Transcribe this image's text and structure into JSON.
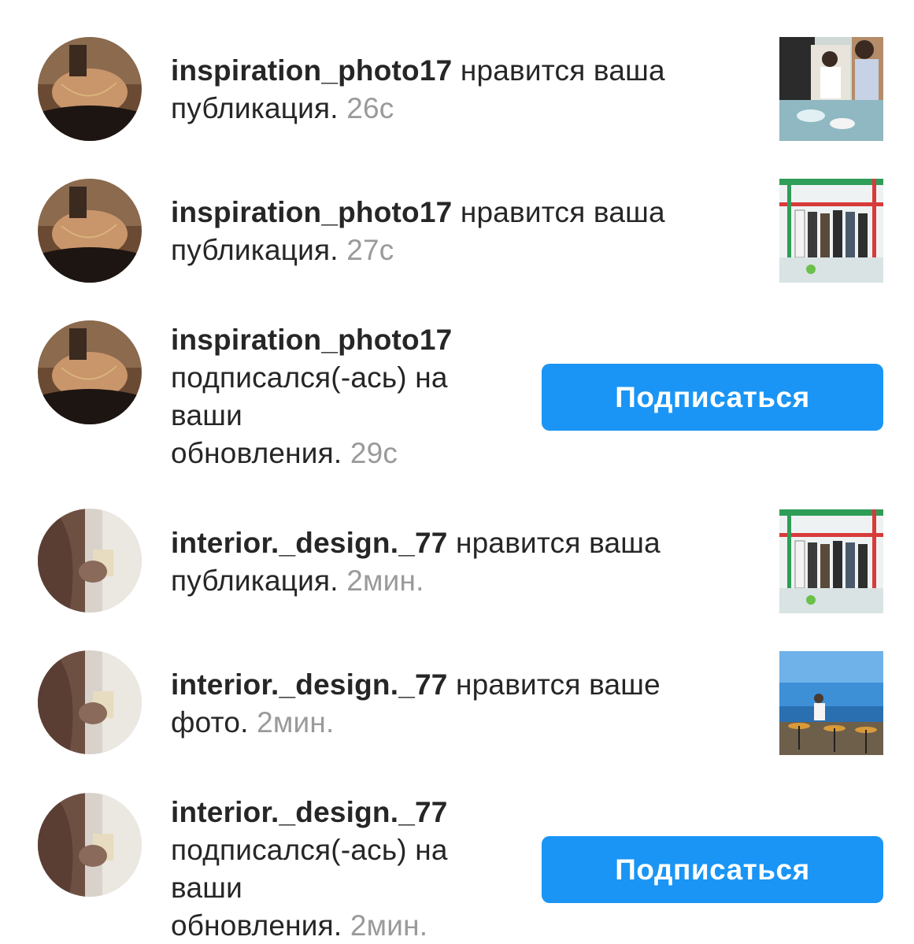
{
  "notifications": [
    {
      "username": "inspiration_photo17",
      "line1_rest": " нравится ваша",
      "line2_text": "публикация.",
      "time": "26с",
      "avatar_icon": "user-avatar-woman-dark",
      "thumbnail_icon": "post-thumbnail-kitchen"
    },
    {
      "username": "inspiration_photo17",
      "line1_rest": " нравится ваша",
      "line2_text": "публикация.",
      "time": "27с",
      "avatar_icon": "user-avatar-woman-dark",
      "thumbnail_icon": "post-thumbnail-group"
    },
    {
      "username": "inspiration_photo17",
      "line2_text": "подписался(-ась) на",
      "line3_text": "ваши",
      "line4_text": "обновления.",
      "time": "29с",
      "button_label": "Подписаться",
      "avatar_icon": "user-avatar-woman-dark"
    },
    {
      "username": "interior._design._77",
      "line1_rest": " нравится ваша",
      "line2_text": "публикация.",
      "time": "2мин.",
      "avatar_icon": "user-avatar-woman-light",
      "thumbnail_icon": "post-thumbnail-group"
    },
    {
      "username": "interior._design._77",
      "line1_rest": " нравится ваше",
      "line2_text": "фото.",
      "time": "2мин.",
      "avatar_icon": "user-avatar-woman-light",
      "thumbnail_icon": "post-thumbnail-seaside"
    },
    {
      "username": "interior._design._77",
      "line2_text": "подписался(-ась) на",
      "line3_text": "ваши",
      "line4_text": "обновления.",
      "time": "2мин.",
      "button_label": "Подписаться",
      "avatar_icon": "user-avatar-woman-light"
    }
  ],
  "colors": {
    "text": "#262626",
    "timestamp": "#9a9a9a",
    "button_bg": "#1a95f5",
    "button_text": "#ffffff"
  }
}
